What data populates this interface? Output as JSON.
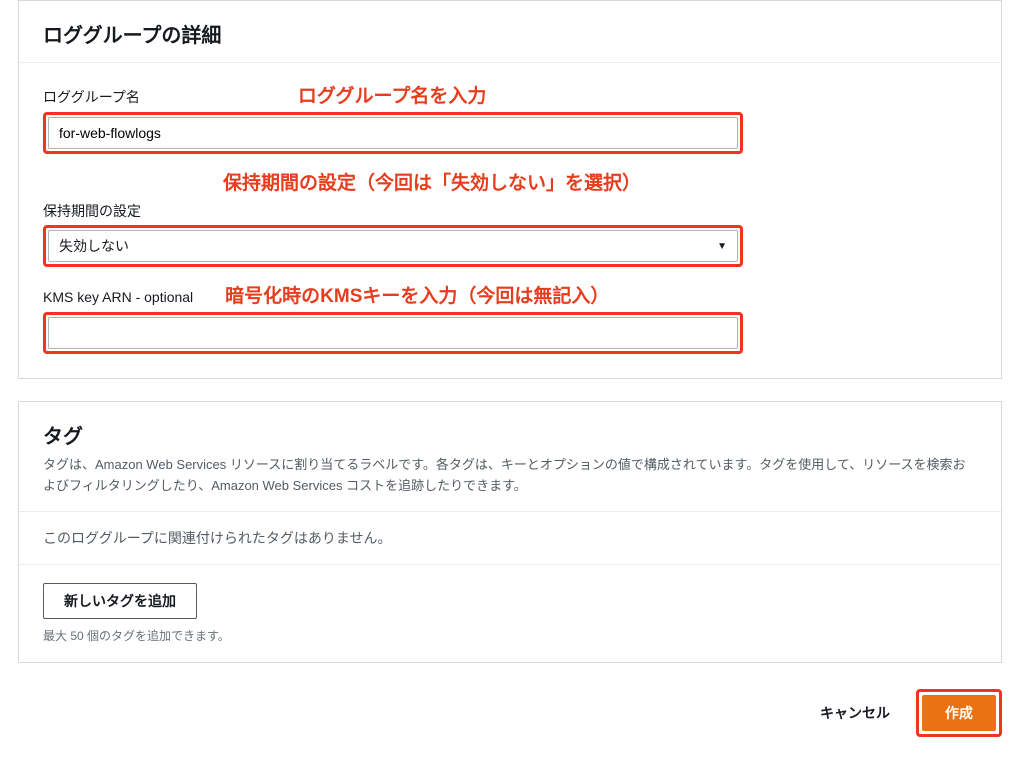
{
  "details": {
    "heading": "ロググループの詳細",
    "fields": {
      "name": {
        "label": "ロググループ名",
        "annotation": "ロググループ名を入力",
        "value": "for-web-flowlogs"
      },
      "retention": {
        "label": "保持期間の設定",
        "annotation": "保持期間の設定（今回は「失効しない」を選択）",
        "value": "失効しない"
      },
      "kms": {
        "label": "KMS key ARN - optional",
        "annotation": "暗号化時のKMSキーを入力（今回は無記入）",
        "value": ""
      }
    }
  },
  "tags": {
    "heading": "タグ",
    "description": "タグは、Amazon Web Services リソースに割り当てるラベルです。各タグは、キーとオプションの値で構成されています。タグを使用して、リソースを検索およびフィルタリングしたり、Amazon Web Services コストを追跡したりできます。",
    "empty": "このロググループに関連付けられたタグはありません。",
    "add_button": "新しいタグを追加",
    "hint": "最大 50 個のタグを追加できます。"
  },
  "footer": {
    "cancel": "キャンセル",
    "submit": "作成"
  }
}
